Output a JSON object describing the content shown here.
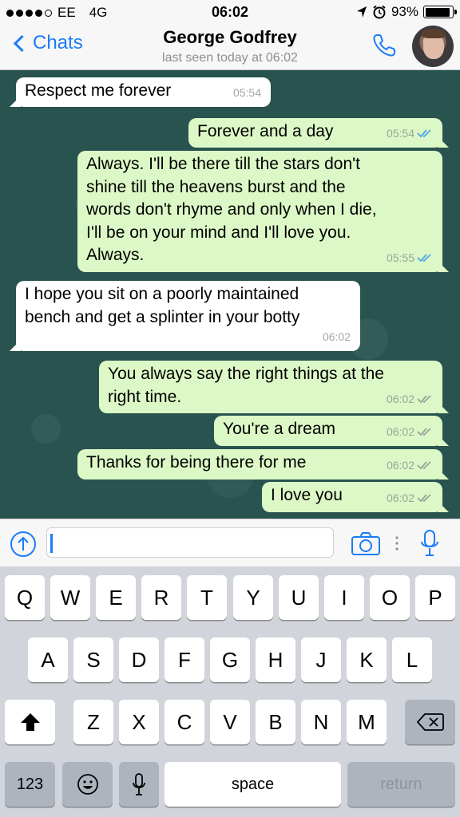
{
  "status_bar": {
    "carrier": "EE",
    "network": "4G",
    "time": "06:02",
    "battery": "93%",
    "battery_level": 0.93
  },
  "header": {
    "back_label": "Chats",
    "contact_name": "George Godfrey",
    "last_seen": "last seen today at 06:02"
  },
  "messages": [
    {
      "direction": "in",
      "text": "Respect me forever",
      "time": "05:54"
    },
    {
      "direction": "out",
      "text": "Forever and a day",
      "time": "05:54",
      "read": true
    },
    {
      "direction": "out",
      "lines": [
        "Always. I'll be there till the stars don't",
        "shine till the heavens burst and the",
        "words don't rhyme and only when I die,",
        "I'll be on your mind and I'll love you.",
        "Always."
      ],
      "time": "05:55",
      "read": true
    },
    {
      "direction": "in",
      "lines": [
        "I hope you sit on a poorly maintained",
        "bench and get a splinter in your botty"
      ],
      "time": "06:02"
    },
    {
      "direction": "out",
      "lines": [
        "You always say the right things at the",
        "right time."
      ],
      "time": "06:02",
      "read": false
    },
    {
      "direction": "out",
      "text": "You're a dream",
      "time": "06:02",
      "read": false
    },
    {
      "direction": "out",
      "text": "Thanks for being there for me",
      "time": "06:02",
      "read": false
    },
    {
      "direction": "out",
      "text": "I love you",
      "time": "06:02",
      "read": false
    }
  ],
  "keyboard": {
    "row1": [
      "Q",
      "W",
      "E",
      "R",
      "T",
      "Y",
      "U",
      "I",
      "O",
      "P"
    ],
    "row2": [
      "A",
      "S",
      "D",
      "F",
      "G",
      "H",
      "J",
      "K",
      "L"
    ],
    "row3": [
      "Z",
      "X",
      "C",
      "V",
      "B",
      "N",
      "M"
    ],
    "numbers_label": "123",
    "space_label": "space",
    "return_label": "return"
  },
  "colors": {
    "accent": "#1a7cf7",
    "outgoing_bubble": "#dcf8c6",
    "incoming_bubble": "#ffffff",
    "chat_background": "#28534f",
    "read_ticks": "#4fa6e8",
    "unread_ticks": "#9aa39a"
  }
}
